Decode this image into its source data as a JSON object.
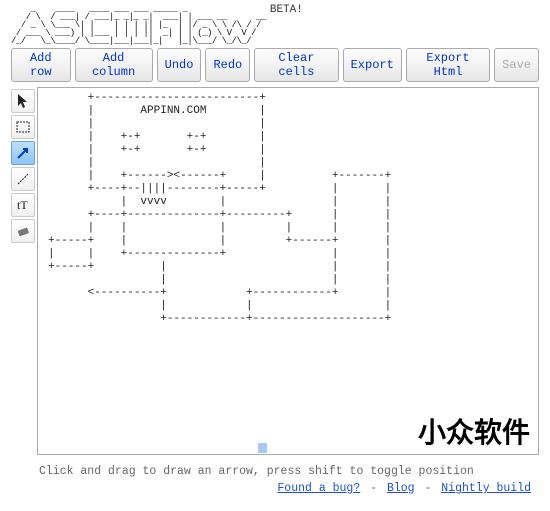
{
  "header": {
    "logo_ascii": "    _    ____   ____ ___ ___ _____ _\n   / \\  / ___| / ___|_ _|_ _|  ___| | ___ __      __\n  / _ \\ \\___ \\| |    | | | || |_  | |/ _ \\ \\ /\\ / /\n / ___ \\ ___) | |___ | | | ||  _| | | (_) \\ V  V /\n/_/   \\_\\____/ \\____|___|___|_|   |_|\\___/ \\_/\\_/",
    "beta": "BETA!"
  },
  "toolbar": {
    "add_row": "Add row",
    "add_column": "Add column",
    "undo": "Undo",
    "redo": "Redo",
    "clear_cells": "Clear cells",
    "export": "Export",
    "export_html": "Export Html",
    "save": "Save"
  },
  "tools": {
    "pointer": "pointer-tool",
    "rect": "rectangle-tool",
    "arrow": "arrow-tool",
    "line": "line-tool",
    "text": "text-tool",
    "erase": "erase-tool",
    "selected": "arrow"
  },
  "canvas": {
    "ascii": "      +-------------------------+\n      |       APPINN.COM        |\n      |                         |\n      |    +-+       +-+        |\n      |    +-+       +-+        |\n      |                         |\n      |    +------><------+     |          +-------+\n      +----+--||||--------+-----+          |       |\n           |  vvvv        |                |       |\n      +----+--------------+---------+      |       |\n      |    |              |         |      |       |\n+-----+    |              |         +------+       |\n|     |    +--------------+                |       |\n+-----+          |                         |       |\n                 |                         |       |\n      <----------+            +------------+       |\n                 |            |                    |\n                 +------------+--------------------+",
    "text_label": "APPINN.COM"
  },
  "watermark": "小众软件",
  "footer": {
    "status": "Click and drag to draw an arrow, press shift to toggle position",
    "bug_link": "Found a bug?",
    "blog_link": "Blog",
    "nightly_link": "Nightly build",
    "sep": " - "
  }
}
